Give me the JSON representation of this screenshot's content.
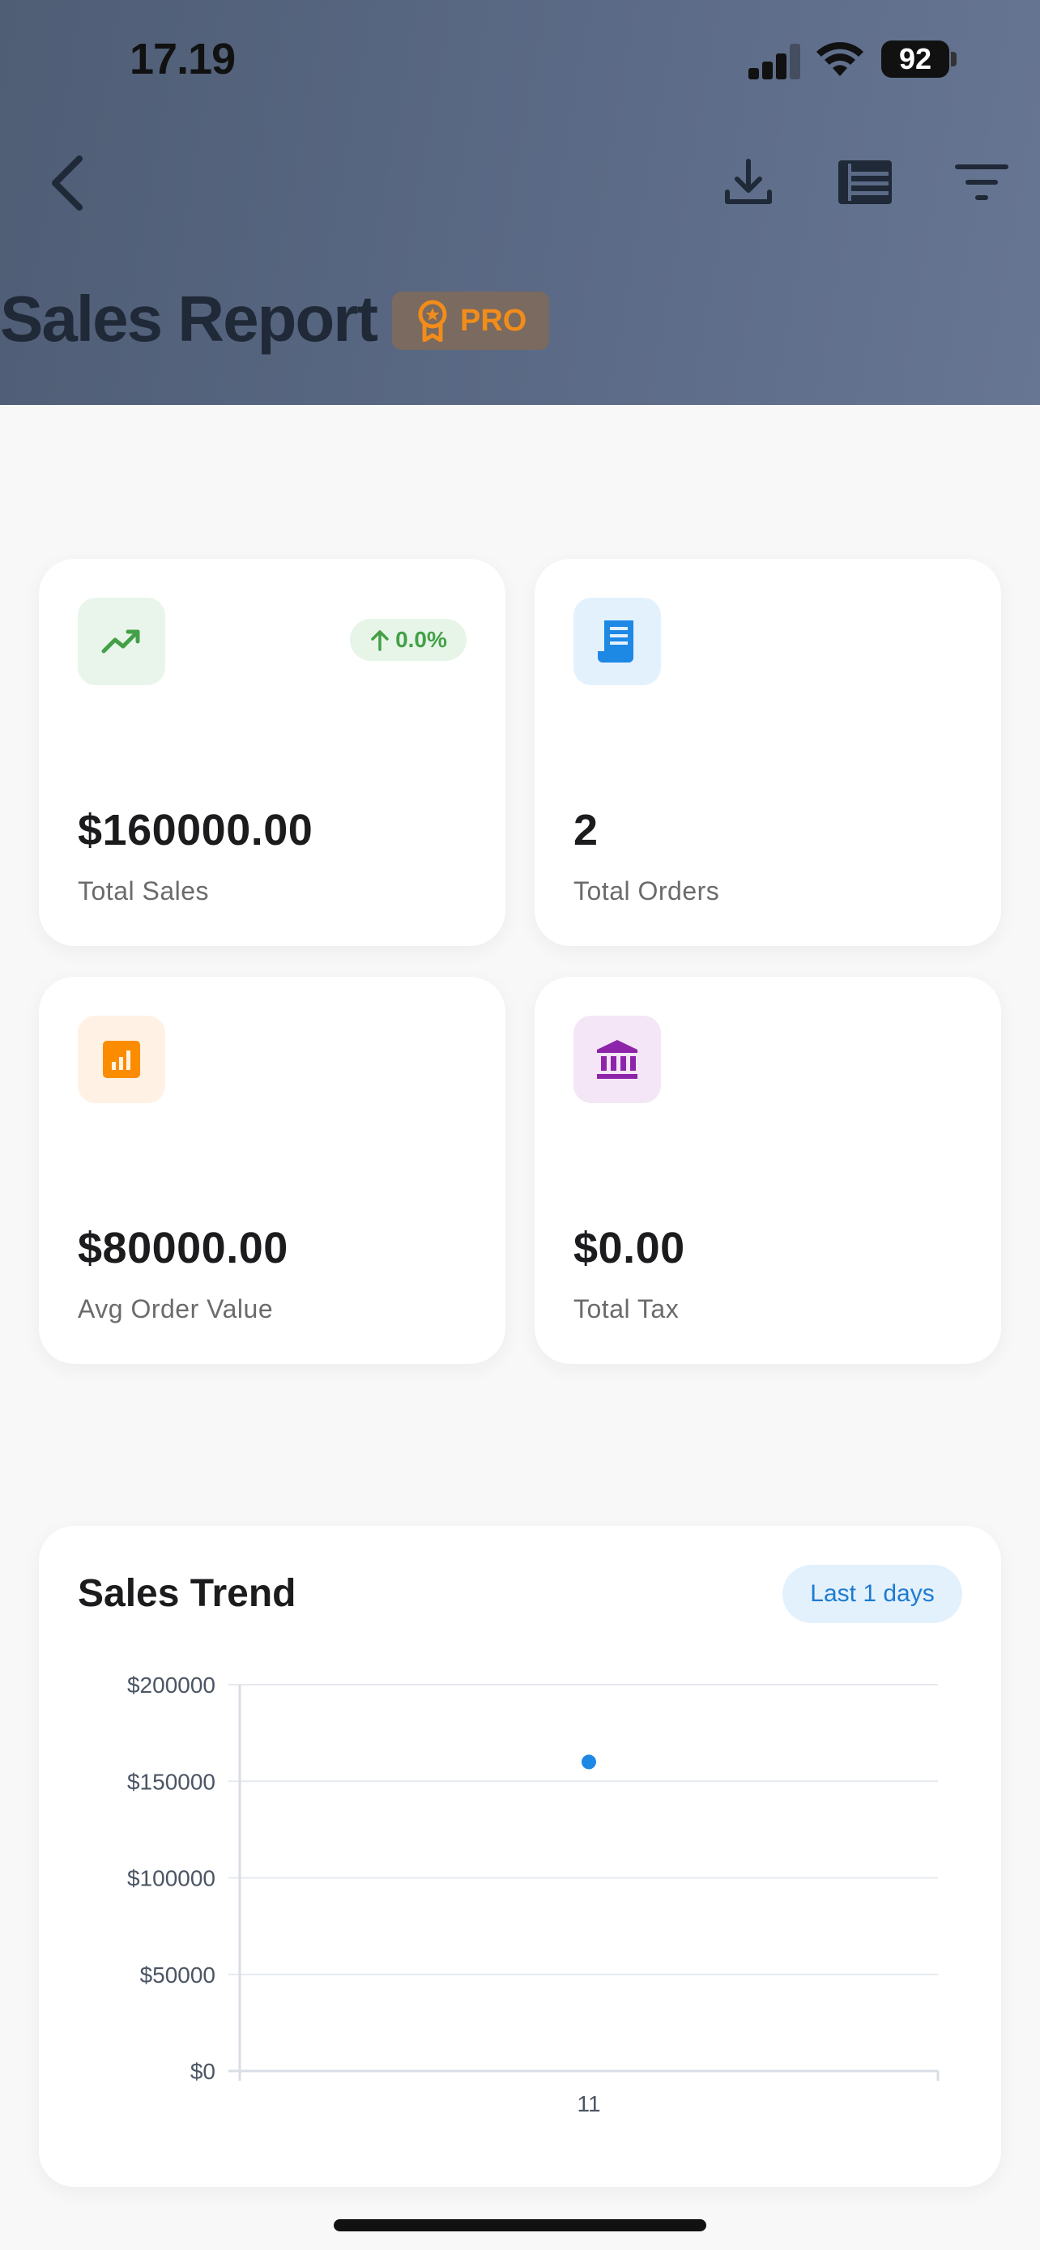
{
  "status_bar": {
    "time": "17.19",
    "battery": "92"
  },
  "header": {
    "title": "Sales Report",
    "badge": "PRO",
    "icons": [
      "back-chevron-icon",
      "download-icon",
      "list-view-icon",
      "filter-icon"
    ]
  },
  "stats": [
    {
      "value": "$160000.00",
      "label": "Total Sales",
      "icon": "trending-up-icon",
      "icon_color": "#43a047",
      "icon_bg": "#e9f5ea",
      "trend": "0.0%"
    },
    {
      "value": "2",
      "label": "Total Orders",
      "icon": "receipt-icon",
      "icon_color": "#1e88e5",
      "icon_bg": "#e3f1fd"
    },
    {
      "value": "$80000.00",
      "label": "Avg Order Value",
      "icon": "bar-chart-icon",
      "icon_color": "#fb8c00",
      "icon_bg": "#fff1e3"
    },
    {
      "value": "$0.00",
      "label": "Total Tax",
      "icon": "bank-icon",
      "icon_color": "#8e24aa",
      "icon_bg": "#f4e6f6"
    }
  ],
  "chart": {
    "title": "Sales Trend",
    "range_label": "Last 1 days"
  },
  "chart_data": {
    "type": "scatter",
    "x": [
      "11"
    ],
    "series": [
      {
        "values": [
          160000
        ]
      }
    ],
    "ylim": [
      0,
      200000
    ],
    "y_ticks": [
      "$0",
      "$50000",
      "$100000",
      "$150000",
      "$200000"
    ],
    "y_tick_values": [
      0,
      50000,
      100000,
      150000,
      200000
    ],
    "grid": true,
    "point_color": "#1e88e5"
  }
}
